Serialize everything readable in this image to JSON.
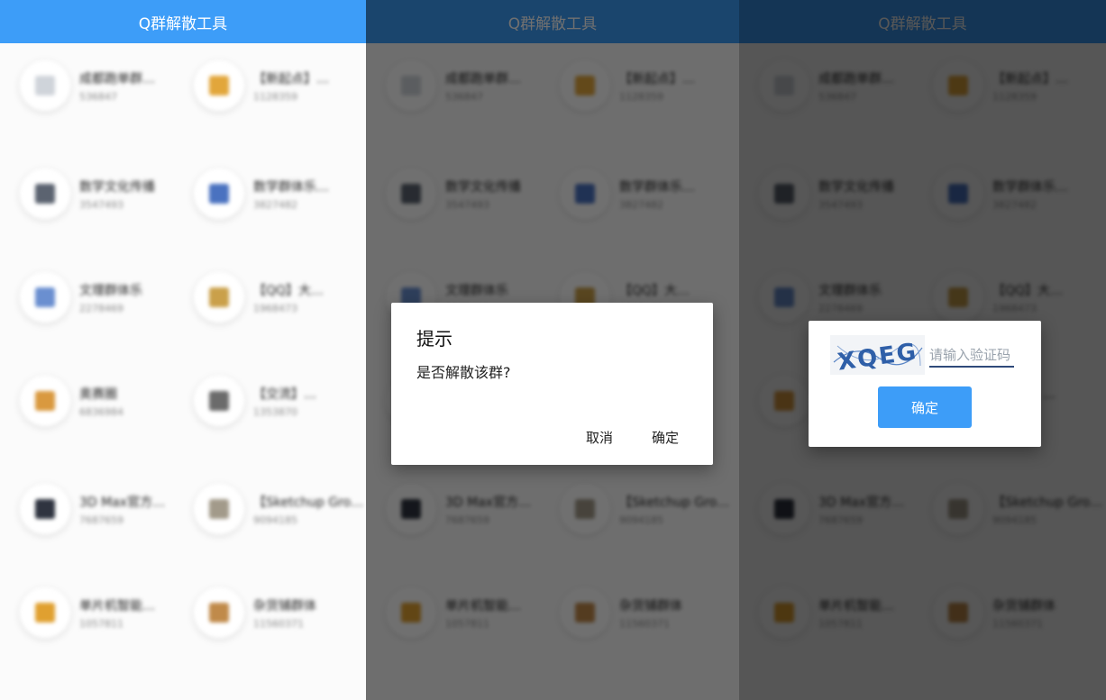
{
  "app": {
    "title": "Q群解散工具"
  },
  "groups": [
    {
      "name": "成都跑单群…",
      "number": "536847",
      "color": "#cfd4da"
    },
    {
      "name": "【新起点】…",
      "number": "1128359",
      "color": "#e2a63b"
    },
    {
      "name": "数学文化传播",
      "number": "3547493",
      "color": "#5b6370"
    },
    {
      "name": "数学群体乐…",
      "number": "3827482",
      "color": "#4a72c0"
    },
    {
      "name": "文理群体乐",
      "number": "2278469",
      "color": "#6a8fd0"
    },
    {
      "name": "【QQ】大…",
      "number": "1968473",
      "color": "#caa04a"
    },
    {
      "name": "奥赛圈",
      "number": "6836984",
      "color": "#d9993f"
    },
    {
      "name": "【交流】…",
      "number": "1353870",
      "color": "#6b6b6b"
    },
    {
      "name": "3D Max官方…",
      "number": "7687659",
      "color": "#2f3440"
    },
    {
      "name": "【Sketchup Gro…",
      "number": "9094185",
      "color": "#a29a8a"
    },
    {
      "name": "单片机智能…",
      "number": "1057811",
      "color": "#e0a030"
    },
    {
      "name": "杂货铺群体",
      "number": "11560371",
      "color": "#c08a4a"
    }
  ],
  "confirm_dialog": {
    "title": "提示",
    "message": "是否解散该群?",
    "cancel_label": "取消",
    "ok_label": "确定"
  },
  "captcha_dialog": {
    "captcha_text": "XQEG",
    "placeholder": "请输入验证码",
    "ok_label": "确定"
  },
  "colors": {
    "accent": "#3d9df8"
  }
}
